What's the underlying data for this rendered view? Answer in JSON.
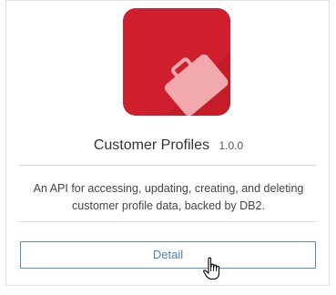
{
  "card": {
    "title": "Customer Profiles",
    "version": "1.0.0",
    "description": "An API for accessing, updating, creating, and deleting customer profile data, backed by DB2.",
    "detail_label": "Detail",
    "icon": "briefcase-icon"
  },
  "colors": {
    "tile": "#cf1f2e",
    "briefcase": "#f1a9ae",
    "button_border": "#5b90c9",
    "button_text": "#4a7fc1"
  }
}
